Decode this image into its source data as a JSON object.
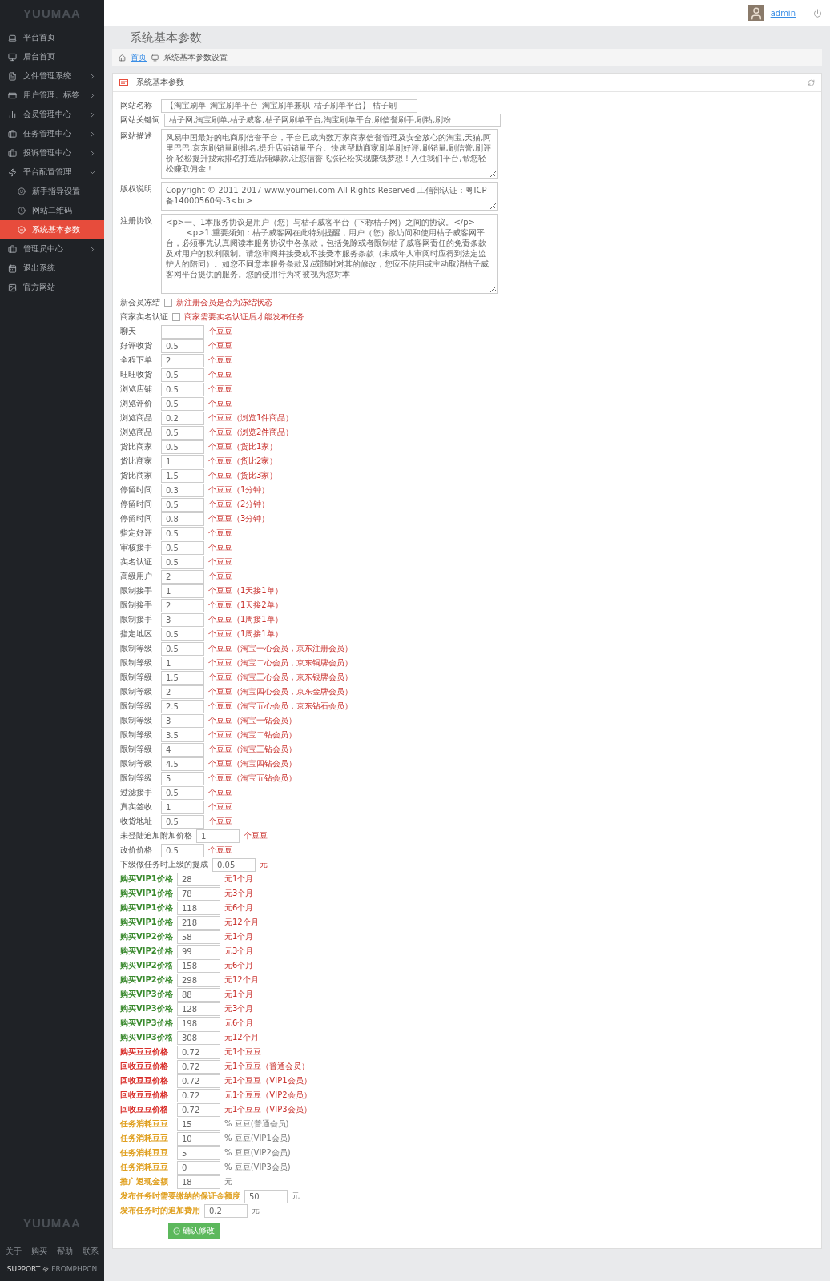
{
  "sidebar": {
    "logo": "YUUMAA",
    "items": [
      {
        "label": "平台首页",
        "selected": false
      },
      {
        "label": "后台首页",
        "selected": false
      },
      {
        "label": "文件管理系统",
        "selected": false,
        "expanded": false
      },
      {
        "label": "用户管理、标签",
        "selected": false,
        "expanded": false
      },
      {
        "label": "会员管理中心",
        "selected": false,
        "expanded": false
      },
      {
        "label": "任务管理中心",
        "selected": false,
        "expanded": false
      },
      {
        "label": "投诉管理中心",
        "selected": false,
        "expanded": false
      },
      {
        "label": "平台配置管理",
        "selected": false,
        "expanded": true,
        "children": [
          {
            "label": "新手指导设置",
            "selected": false
          },
          {
            "label": "网站二维码",
            "selected": false
          },
          {
            "label": "系统基本参数",
            "selected": true
          }
        ]
      },
      {
        "label": "管理员中心",
        "selected": false,
        "expanded": false
      },
      {
        "label": "退出系统",
        "selected": false
      },
      {
        "label": "官方网站",
        "selected": false
      }
    ],
    "footer": {
      "logo": "YUUMAA",
      "links": [
        "关于",
        "购买",
        "帮助",
        "联系"
      ],
      "support": "SUPPORT",
      "brand": "FROMPHPCN"
    }
  },
  "header": {
    "user": "admin"
  },
  "page": {
    "title": "系统基本参数",
    "breadcrumb": [
      "首页",
      "系统基本参数设置"
    ]
  },
  "panel": {
    "title": "系统基本参数",
    "submit": "确认修改",
    "fields": [
      {
        "kind": "short",
        "label": "网站名称",
        "value": "【淘宝刷单_淘宝刷单平台_淘宝刷单兼职_桔子刷单平台】 桔子刷"
      },
      {
        "kind": "long",
        "label": "网站关键词",
        "value": "桔子网,淘宝刷单,桔子威客,桔子网刷单平台,淘宝刷单平台,刷信誉刷手,刷钻,刷粉"
      },
      {
        "kind": "textarea",
        "label": "网站描述",
        "value": "风易中国最好的电商刷信誉平台，平台已成为数万家商家信誉管理及安全放心的淘宝,天猫,阿里巴巴,京东刷销量刷排名,提升店铺销量平台。快速帮助商家刷单刷好评,刷销量,刷信誉,刷评价,轻松提升搜索排名打造店铺爆款,让您信誉飞涨轻松实现赚钱梦想！入住我们平台,帮您轻松赚取佣金！"
      },
      {
        "kind": "textarea",
        "label": "版权说明",
        "value": "Copyright © 2011-2017 www.youmei.com All Rights Reserved 工信部认证：粤ICP备14000560号-3<br>"
      },
      {
        "kind": "textarea",
        "label": "注册协议",
        "value": "<p>一、1本服务协议是用户（您）与桔子威客平台（下称桔子网）之间的协议。</p>\n        <p>1.重要须知：桔子威客网在此特别提醒，用户（您）欲访问和使用桔子威客网平台，必须事先认真阅读本服务协议中各条款，包括免除或者限制桔子威客网责任的免责条款及对用户的权利限制。请您审阅并接受或不接受本服务条款（未成年人审阅时应得到法定监护人的陪同）。如您不同意本服务条款及/或随时对其的修改，您应不使用或主动取消桔子威客网平台提供的服务。您的使用行为将被视为您对本"
      },
      {
        "kind": "checkbox",
        "label": "新会员冻结",
        "checked": false,
        "note": "新注册会员是否为冻结状态"
      },
      {
        "kind": "checkbox",
        "label": "商家实名认证",
        "checked": false,
        "note": "商家需要实名认证后才能发布任务"
      },
      {
        "kind": "text",
        "label": "聊天",
        "suffix": "个豆豆"
      },
      {
        "kind": "text",
        "label": "好评收货",
        "value": "0.5",
        "suffix": "个豆豆"
      },
      {
        "kind": "text",
        "label": "全程下单",
        "value": "2",
        "suffix": "个豆豆"
      },
      {
        "kind": "text",
        "label": "旺旺收货",
        "value": "0.5",
        "suffix": "个豆豆"
      },
      {
        "kind": "text",
        "label": "浏览店铺",
        "value": "0.5",
        "suffix": "个豆豆"
      },
      {
        "kind": "text",
        "label": "浏览评价",
        "value": "0.5",
        "suffix": "个豆豆"
      },
      {
        "kind": "text",
        "label": "浏览商品",
        "value": "0.2",
        "suffix": "个豆豆（浏览1件商品）"
      },
      {
        "kind": "text",
        "label": "浏览商品",
        "value": "0.5",
        "suffix": "个豆豆（浏览2件商品）"
      },
      {
        "kind": "text",
        "label": "货比商家",
        "value": "0.5",
        "suffix": "个豆豆（货比1家）"
      },
      {
        "kind": "text",
        "label": "货比商家",
        "value": "1",
        "suffix": "个豆豆（货比2家）"
      },
      {
        "kind": "text",
        "label": "货比商家",
        "value": "1.5",
        "suffix": "个豆豆（货比3家）"
      },
      {
        "kind": "text",
        "label": "停留时间",
        "value": "0.3",
        "suffix": "个豆豆（1分钟）"
      },
      {
        "kind": "text",
        "label": "停留时间",
        "value": "0.5",
        "suffix": "个豆豆（2分钟）"
      },
      {
        "kind": "text",
        "label": "停留时间",
        "value": "0.8",
        "suffix": "个豆豆（3分钟）"
      },
      {
        "kind": "text",
        "label": "指定好评",
        "value": "0.5",
        "suffix": "个豆豆"
      },
      {
        "kind": "text",
        "label": "审核接手",
        "value": "0.5",
        "suffix": "个豆豆"
      },
      {
        "kind": "text",
        "label": "实名认证",
        "value": "0.5",
        "suffix": "个豆豆"
      },
      {
        "kind": "text",
        "label": "高级用户",
        "value": "2",
        "suffix": "个豆豆"
      },
      {
        "kind": "text",
        "label": "限制接手",
        "value": "1",
        "suffix": "个豆豆（1天接1单）"
      },
      {
        "kind": "text",
        "label": "限制接手",
        "value": "2",
        "suffix": "个豆豆（1天接2单）"
      },
      {
        "kind": "text",
        "label": "限制接手",
        "value": "3",
        "suffix": "个豆豆（1周接1单）"
      },
      {
        "kind": "text",
        "label": "指定地区",
        "value": "0.5",
        "suffix": "个豆豆（1周接1单）"
      },
      {
        "kind": "text",
        "label": "限制等级",
        "value": "0.5",
        "suffix": "个豆豆（淘宝一心会员，京东注册会员）"
      },
      {
        "kind": "text",
        "label": "限制等级",
        "value": "1",
        "suffix": "个豆豆（淘宝二心会员，京东铜牌会员）"
      },
      {
        "kind": "text",
        "label": "限制等级",
        "value": "1.5",
        "suffix": "个豆豆（淘宝三心会员，京东银牌会员）"
      },
      {
        "kind": "text",
        "label": "限制等级",
        "value": "2",
        "suffix": "个豆豆（淘宝四心会员，京东金牌会员）"
      },
      {
        "kind": "text",
        "label": "限制等级",
        "value": "2.5",
        "suffix": "个豆豆（淘宝五心会员，京东钻石会员）"
      },
      {
        "kind": "text",
        "label": "限制等级",
        "value": "3",
        "suffix": "个豆豆（淘宝一钻会员）"
      },
      {
        "kind": "text",
        "label": "限制等级",
        "value": "3.5",
        "suffix": "个豆豆（淘宝二钻会员）"
      },
      {
        "kind": "text",
        "label": "限制等级",
        "value": "4",
        "suffix": "个豆豆（淘宝三钻会员）"
      },
      {
        "kind": "text",
        "label": "限制等级",
        "value": "4.5",
        "suffix": "个豆豆（淘宝四钻会员）"
      },
      {
        "kind": "text",
        "label": "限制等级",
        "value": "5",
        "suffix": "个豆豆（淘宝五钻会员）"
      },
      {
        "kind": "text",
        "label": "过滤接手",
        "value": "0.5",
        "suffix": "个豆豆"
      },
      {
        "kind": "text",
        "label": "真实签收",
        "value": "1",
        "suffix": "个豆豆"
      },
      {
        "kind": "text",
        "label": "收货地址",
        "value": "0.5",
        "suffix": "个豆豆"
      },
      {
        "kind": "text",
        "label": "未登陆追加附加价格",
        "value": "1",
        "suffix": "个豆豆"
      },
      {
        "kind": "text",
        "label": "改价价格",
        "value": "0.5",
        "suffix": "个豆豆"
      },
      {
        "kind": "text",
        "label": "下级做任务时上级的提成",
        "value": "0.05",
        "suffix": "元"
      },
      {
        "kind": "text",
        "label": "购买VIP1价格",
        "value": "28",
        "suffix": "元1个月",
        "color": "#3a8a2e"
      },
      {
        "kind": "text",
        "label": "购买VIP1价格",
        "value": "78",
        "suffix": "元3个月",
        "color": "#3a8a2e"
      },
      {
        "kind": "text",
        "label": "购买VIP1价格",
        "value": "118",
        "suffix": "元6个月",
        "color": "#3a8a2e"
      },
      {
        "kind": "text",
        "label": "购买VIP1价格",
        "value": "218",
        "suffix": "元12个月",
        "color": "#3a8a2e"
      },
      {
        "kind": "text",
        "label": "购买VIP2价格",
        "value": "58",
        "suffix": "元1个月",
        "color": "#3a8a2e"
      },
      {
        "kind": "text",
        "label": "购买VIP2价格",
        "value": "99",
        "suffix": "元3个月",
        "color": "#3a8a2e"
      },
      {
        "kind": "text",
        "label": "购买VIP2价格",
        "value": "158",
        "suffix": "元6个月",
        "color": "#3a8a2e"
      },
      {
        "kind": "text",
        "label": "购买VIP2价格",
        "value": "298",
        "suffix": "元12个月",
        "color": "#3a8a2e"
      },
      {
        "kind": "text",
        "label": "购买VIP3价格",
        "value": "88",
        "suffix": "元1个月",
        "color": "#3a8a2e"
      },
      {
        "kind": "text",
        "label": "购买VIP3价格",
        "value": "128",
        "suffix": "元3个月",
        "color": "#3a8a2e"
      },
      {
        "kind": "text",
        "label": "购买VIP3价格",
        "value": "198",
        "suffix": "元6个月",
        "color": "#3a8a2e"
      },
      {
        "kind": "text",
        "label": "购买VIP3价格",
        "value": "308",
        "suffix": "元12个月",
        "color": "#3a8a2e"
      },
      {
        "kind": "text",
        "label": "购买豆豆价格",
        "value": "0.72",
        "suffix": "元1个豆豆",
        "color": "#d9302c"
      },
      {
        "kind": "text",
        "label": "回收豆豆价格",
        "value": "0.72",
        "suffix": "元1个豆豆（普通会员）",
        "color": "#d9302c"
      },
      {
        "kind": "text",
        "label": "回收豆豆价格",
        "value": "0.72",
        "suffix": "元1个豆豆（VIP1会员）",
        "color": "#d9302c"
      },
      {
        "kind": "text",
        "label": "回收豆豆价格",
        "value": "0.72",
        "suffix": "元1个豆豆（VIP2会员）",
        "color": "#d9302c"
      },
      {
        "kind": "text",
        "label": "回收豆豆价格",
        "value": "0.72",
        "suffix": "元1个豆豆（VIP3会员）",
        "color": "#d9302c"
      },
      {
        "kind": "text",
        "label": "任务消耗豆豆",
        "value": "15",
        "suffix": "% 豆豆(普通会员)",
        "color": "#e0a020"
      },
      {
        "kind": "text",
        "label": "任务消耗豆豆",
        "value": "10",
        "suffix": "% 豆豆(VIP1会员)",
        "color": "#e0a020"
      },
      {
        "kind": "text",
        "label": "任务消耗豆豆",
        "value": "5",
        "suffix": "% 豆豆(VIP2会员)",
        "color": "#e0a020"
      },
      {
        "kind": "text",
        "label": "任务消耗豆豆",
        "value": "0",
        "suffix": "% 豆豆(VIP3会员)",
        "color": "#e0a020"
      },
      {
        "kind": "text",
        "label": "推广返现金额",
        "value": "18",
        "suffix": "元",
        "color": "#e0a020"
      },
      {
        "kind": "text",
        "label": "发布任务时需要缴纳的保证金额度",
        "value": "50",
        "suffix": "元",
        "color": "#e0a020"
      },
      {
        "kind": "text",
        "label": "发布任务时的追加费用",
        "value": "0.2",
        "suffix": "元",
        "color": "#e0a020"
      }
    ]
  }
}
